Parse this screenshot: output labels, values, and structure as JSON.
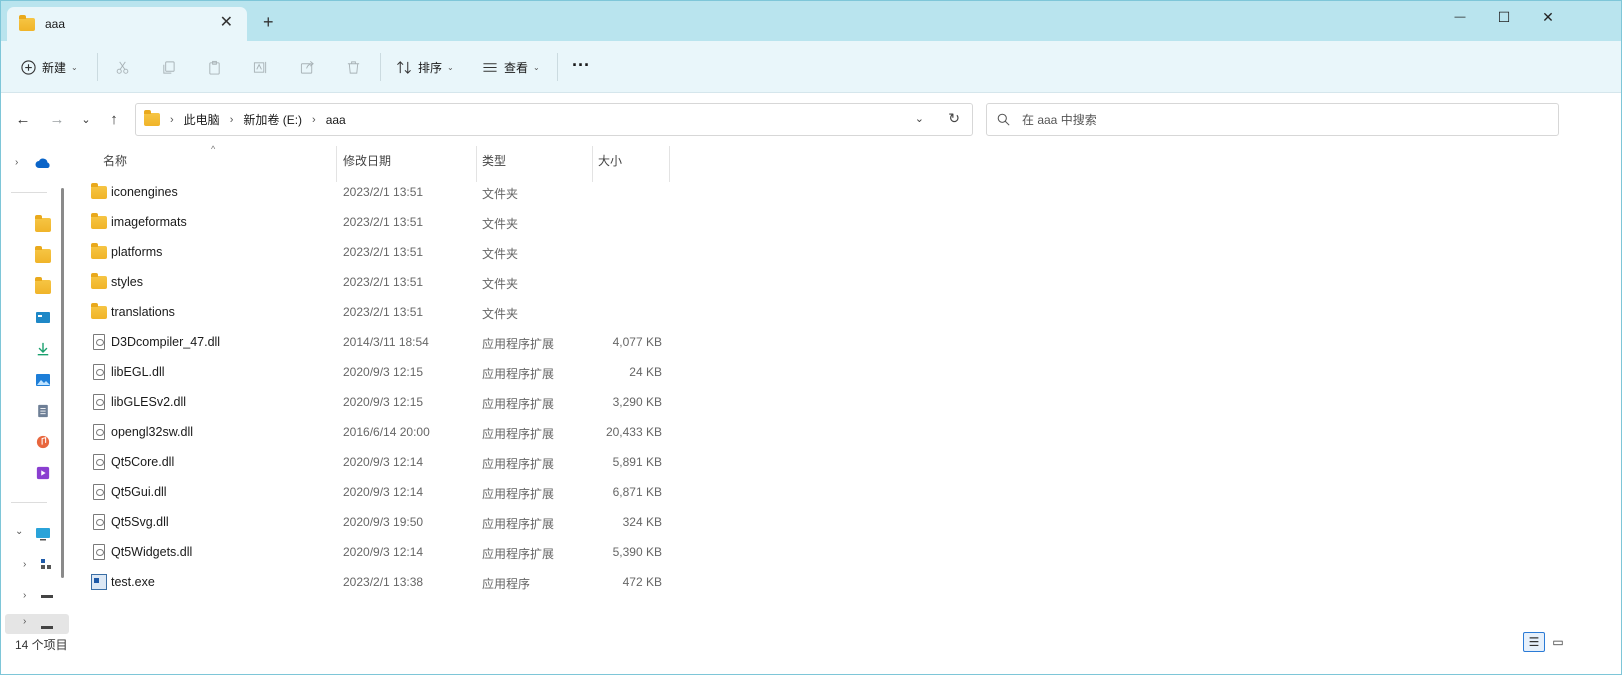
{
  "window": {
    "tab_title": "aaa",
    "tab_close": "✕",
    "new_tab": "+",
    "minimize": "—",
    "maximize": "☐",
    "close": "✕"
  },
  "toolbar": {
    "new_label": "新建",
    "sort_label": "排序",
    "view_label": "查看",
    "more": "···"
  },
  "address": {
    "crumbs": [
      "此电脑",
      "新加卷 (E:)",
      "aaa"
    ],
    "search_placeholder": "在 aaa 中搜索"
  },
  "columns": {
    "name": "名称",
    "date": "修改日期",
    "type": "类型",
    "size": "大小"
  },
  "files": [
    {
      "name": "iconengines",
      "date": "2023/2/1 13:51",
      "type": "文件夹",
      "size": "",
      "kind": "folder"
    },
    {
      "name": "imageformats",
      "date": "2023/2/1 13:51",
      "type": "文件夹",
      "size": "",
      "kind": "folder"
    },
    {
      "name": "platforms",
      "date": "2023/2/1 13:51",
      "type": "文件夹",
      "size": "",
      "kind": "folder"
    },
    {
      "name": "styles",
      "date": "2023/2/1 13:51",
      "type": "文件夹",
      "size": "",
      "kind": "folder"
    },
    {
      "name": "translations",
      "date": "2023/2/1 13:51",
      "type": "文件夹",
      "size": "",
      "kind": "folder"
    },
    {
      "name": "D3Dcompiler_47.dll",
      "date": "2014/3/11 18:54",
      "type": "应用程序扩展",
      "size": "4,077 KB",
      "kind": "dll"
    },
    {
      "name": "libEGL.dll",
      "date": "2020/9/3 12:15",
      "type": "应用程序扩展",
      "size": "24 KB",
      "kind": "dll"
    },
    {
      "name": "libGLESv2.dll",
      "date": "2020/9/3 12:15",
      "type": "应用程序扩展",
      "size": "3,290 KB",
      "kind": "dll"
    },
    {
      "name": "opengl32sw.dll",
      "date": "2016/6/14 20:00",
      "type": "应用程序扩展",
      "size": "20,433 KB",
      "kind": "dll"
    },
    {
      "name": "Qt5Core.dll",
      "date": "2020/9/3 12:14",
      "type": "应用程序扩展",
      "size": "5,891 KB",
      "kind": "dll"
    },
    {
      "name": "Qt5Gui.dll",
      "date": "2020/9/3 12:14",
      "type": "应用程序扩展",
      "size": "6,871 KB",
      "kind": "dll"
    },
    {
      "name": "Qt5Svg.dll",
      "date": "2020/9/3 19:50",
      "type": "应用程序扩展",
      "size": "324 KB",
      "kind": "dll"
    },
    {
      "name": "Qt5Widgets.dll",
      "date": "2020/9/3 12:14",
      "type": "应用程序扩展",
      "size": "5,390 KB",
      "kind": "dll"
    },
    {
      "name": "test.exe",
      "date": "2023/2/1 13:38",
      "type": "应用程序",
      "size": "472 KB",
      "kind": "exe"
    }
  ],
  "status": {
    "item_count": "14 个项目"
  },
  "colors": {
    "titlebar": "#b9e4ee",
    "commandbar": "#e9f6fa",
    "accent": "#2b7bd6",
    "folder": "#f0b429"
  },
  "icons": {
    "nav": [
      "onedrive-icon",
      "folder-icon",
      "folder-icon",
      "folder-icon",
      "desktop-icon",
      "downloads-icon",
      "pictures-icon",
      "documents-icon",
      "music-icon",
      "videos-icon",
      "this-pc-icon",
      "network-icon",
      "drive-icon",
      "drive-icon"
    ]
  }
}
